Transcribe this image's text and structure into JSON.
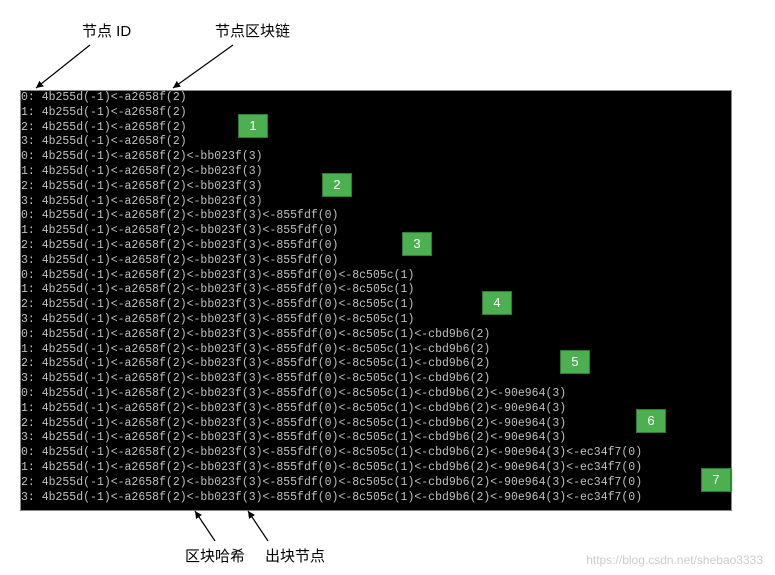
{
  "labels": {
    "nodeId": "节点 ID",
    "nodeBlockchain": "节点区块链",
    "blockHash": "区块哈希",
    "producerNode": "出块节点"
  },
  "badges": [
    "1",
    "2",
    "3",
    "4",
    "5",
    "6",
    "7"
  ],
  "lines": [
    "0: 4b255d(-1)<-a2658f(2)",
    "1: 4b255d(-1)<-a2658f(2)",
    "2: 4b255d(-1)<-a2658f(2)",
    "3: 4b255d(-1)<-a2658f(2)",
    "0: 4b255d(-1)<-a2658f(2)<-bb023f(3)",
    "1: 4b255d(-1)<-a2658f(2)<-bb023f(3)",
    "2: 4b255d(-1)<-a2658f(2)<-bb023f(3)",
    "3: 4b255d(-1)<-a2658f(2)<-bb023f(3)",
    "0: 4b255d(-1)<-a2658f(2)<-bb023f(3)<-855fdf(0)",
    "1: 4b255d(-1)<-a2658f(2)<-bb023f(3)<-855fdf(0)",
    "2: 4b255d(-1)<-a2658f(2)<-bb023f(3)<-855fdf(0)",
    "3: 4b255d(-1)<-a2658f(2)<-bb023f(3)<-855fdf(0)",
    "0: 4b255d(-1)<-a2658f(2)<-bb023f(3)<-855fdf(0)<-8c505c(1)",
    "1: 4b255d(-1)<-a2658f(2)<-bb023f(3)<-855fdf(0)<-8c505c(1)",
    "2: 4b255d(-1)<-a2658f(2)<-bb023f(3)<-855fdf(0)<-8c505c(1)",
    "3: 4b255d(-1)<-a2658f(2)<-bb023f(3)<-855fdf(0)<-8c505c(1)",
    "0: 4b255d(-1)<-a2658f(2)<-bb023f(3)<-855fdf(0)<-8c505c(1)<-cbd9b6(2)",
    "1: 4b255d(-1)<-a2658f(2)<-bb023f(3)<-855fdf(0)<-8c505c(1)<-cbd9b6(2)",
    "2: 4b255d(-1)<-a2658f(2)<-bb023f(3)<-855fdf(0)<-8c505c(1)<-cbd9b6(2)",
    "3: 4b255d(-1)<-a2658f(2)<-bb023f(3)<-855fdf(0)<-8c505c(1)<-cbd9b6(2)",
    "0: 4b255d(-1)<-a2658f(2)<-bb023f(3)<-855fdf(0)<-8c505c(1)<-cbd9b6(2)<-90e964(3)",
    "1: 4b255d(-1)<-a2658f(2)<-bb023f(3)<-855fdf(0)<-8c505c(1)<-cbd9b6(2)<-90e964(3)",
    "2: 4b255d(-1)<-a2658f(2)<-bb023f(3)<-855fdf(0)<-8c505c(1)<-cbd9b6(2)<-90e964(3)",
    "3: 4b255d(-1)<-a2658f(2)<-bb023f(3)<-855fdf(0)<-8c505c(1)<-cbd9b6(2)<-90e964(3)",
    "0: 4b255d(-1)<-a2658f(2)<-bb023f(3)<-855fdf(0)<-8c505c(1)<-cbd9b6(2)<-90e964(3)<-ec34f7(0)",
    "1: 4b255d(-1)<-a2658f(2)<-bb023f(3)<-855fdf(0)<-8c505c(1)<-cbd9b6(2)<-90e964(3)<-ec34f7(0)",
    "2: 4b255d(-1)<-a2658f(2)<-bb023f(3)<-855fdf(0)<-8c505c(1)<-cbd9b6(2)<-90e964(3)<-ec34f7(0)",
    "3: 4b255d(-1)<-a2658f(2)<-bb023f(3)<-855fdf(0)<-8c505c(1)<-cbd9b6(2)<-90e964(3)<-ec34f7(0)"
  ],
  "watermark": "https://blog.csdn.net/shebao3333"
}
